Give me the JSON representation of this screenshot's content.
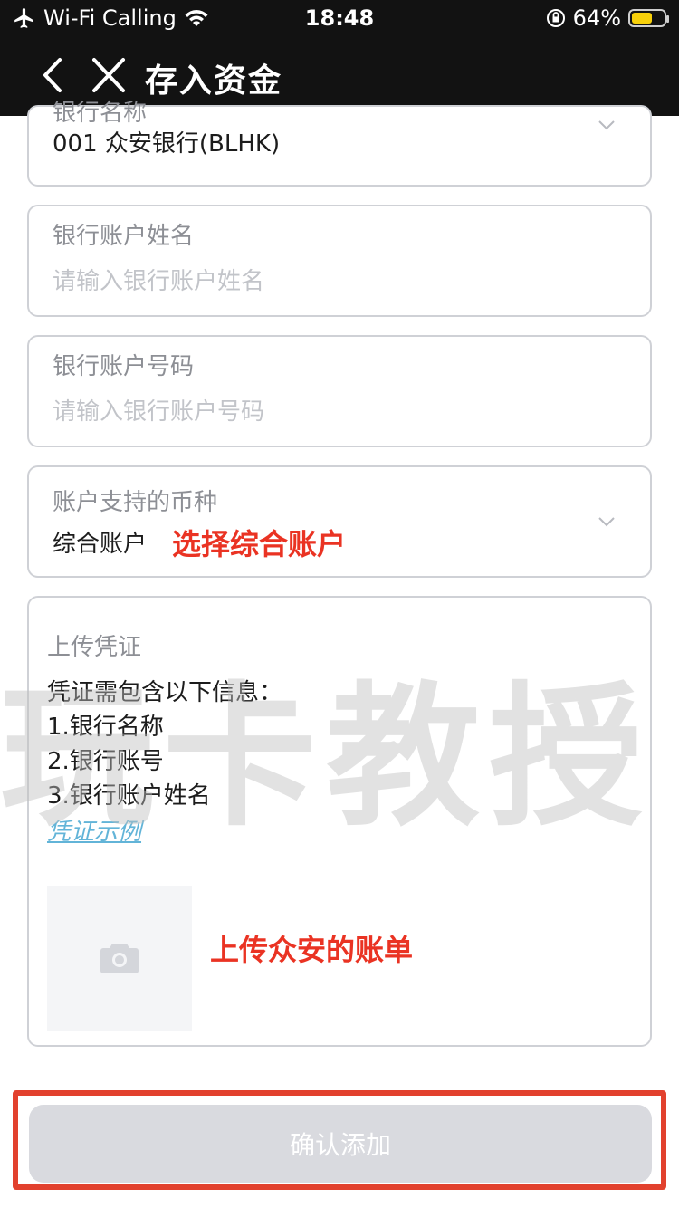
{
  "status_bar": {
    "carrier": "Wi-Fi Calling",
    "time": "18:48",
    "battery": "64%",
    "battery_level": 0.64,
    "icons": [
      "airplane-icon",
      "wifi-icon",
      "orientation-lock-icon",
      "battery-icon"
    ]
  },
  "nav": {
    "title": "存入资金",
    "back_icon": "chevron-left-icon",
    "close_icon": "close-icon"
  },
  "form": {
    "bank_select": {
      "label": "银行名称",
      "value": "001 众安银行(BLHK)"
    },
    "account_name": {
      "label": "银行账户姓名",
      "placeholder": "请输入银行账户姓名"
    },
    "account_number": {
      "label": "银行账户号码",
      "placeholder": "请输入银行账户号码"
    },
    "currency": {
      "label": "账户支持的币种",
      "value": "综合账户",
      "annotation": "选择综合账户"
    },
    "upload": {
      "label": "上传凭证",
      "info_lines": [
        "凭证需包含以下信息：",
        "1.银行名称",
        "2.银行账号",
        "3.银行账户姓名"
      ],
      "example_link": "凭证示例",
      "annotation": "上传众安的账单"
    }
  },
  "watermark": "玩卡教授",
  "confirm_button": {
    "label": "确认添加"
  },
  "colors": {
    "annotation": "#ea3323",
    "link": "#62b4d8",
    "button_bg": "#d9dadf",
    "highlight_box": "#e2412e"
  }
}
